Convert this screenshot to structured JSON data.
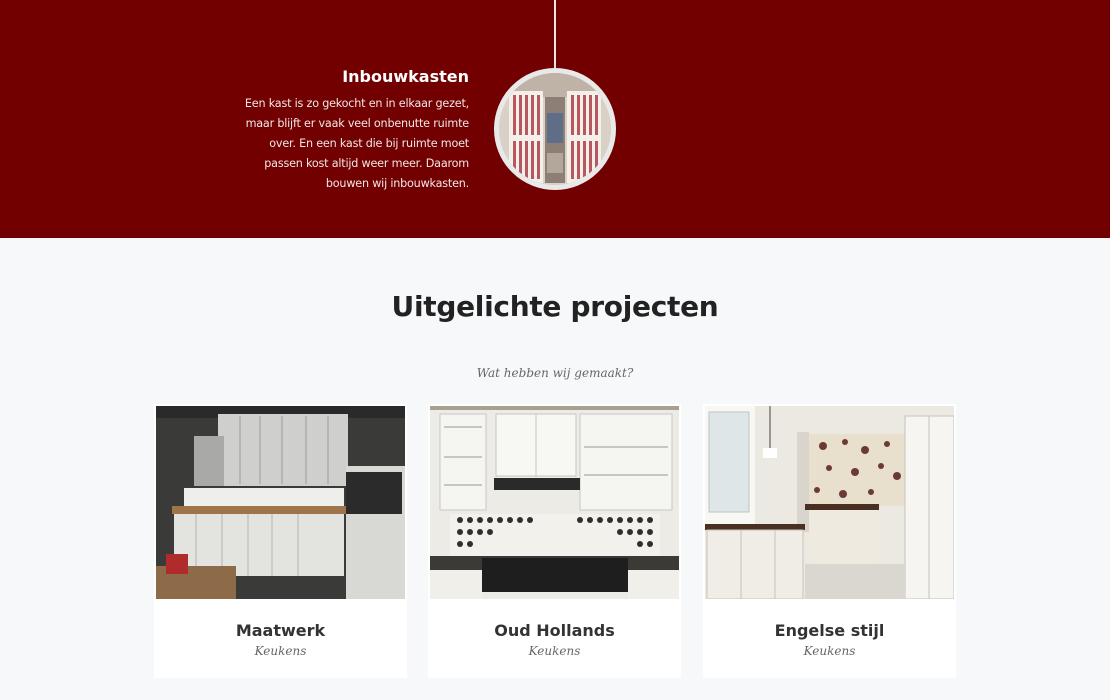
{
  "timeline": {
    "title": "Inbouwkasten",
    "description": "Een kast is zo gekocht en in elkaar gezet, maar blijft er vaak veel onbenutte ruimte over. En een kast die bij ruimte moet passen kost altijd weer meer. Daarom bouwen wij inbouwkasten."
  },
  "projects": {
    "title": "Uitgelichte projecten",
    "subtitle": "Wat hebben wij gemaakt?",
    "items": [
      {
        "name": "Maatwerk",
        "category": "Keukens"
      },
      {
        "name": "Oud Hollands",
        "category": "Keukens"
      },
      {
        "name": "Engelse stijl",
        "category": "Keukens"
      }
    ]
  },
  "colors": {
    "hero_background": "#720000",
    "page_background": "#f7f8fa",
    "card_background": "#ffffff"
  }
}
